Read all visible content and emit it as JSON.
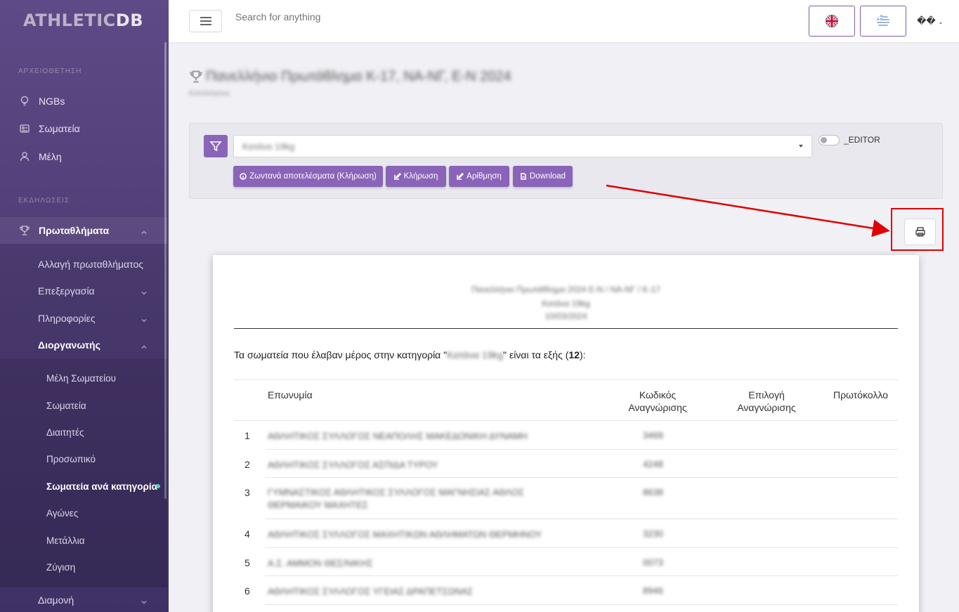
{
  "logo": {
    "part1": "ATHLETIC",
    "part2": "DB"
  },
  "sidebar": {
    "section1": "ΑΡΧΕΙΟΘΕΤΗΣΗ",
    "section2": "ΕΚΔΗΛΩΣΕΙΣ",
    "items": {
      "ngbs": "NGBs",
      "clubs": "Σωματεία",
      "members": "Μέλη",
      "championships": "Πρωταθλήματα",
      "change_championship": "Αλλαγή πρωταθλήματος",
      "editing": "Επεξεργασία",
      "info": "Πληροφορίες",
      "organizer": "Διοργανωτής",
      "club_members": "Μέλη Σωματείου",
      "org_clubs": "Σωματεία",
      "referees": "Διαιτητές",
      "staff": "Προσωπικό",
      "clubs_by_category": "Σωματεία ανά κατηγορία",
      "matches": "Αγώνες",
      "medals": "Μετάλλια",
      "weighing": "Ζύγιση",
      "accommodation": "Διαμονή"
    }
  },
  "topbar": {
    "search_placeholder": "Search for anything",
    "user_label": "��",
    "accent": "#7d5ea8"
  },
  "page": {
    "title": "Πανελλήνιο Πρωτάθλημα Κ-17, ΝΑ-ΝΓ, Ε-Ν 2024",
    "subtitle": "Καταλόγους"
  },
  "filter": {
    "selected": "Κατάνα 19kg",
    "toggle_label": "_EDITOR",
    "buttons": {
      "live": "Ζωντανά αποτελέσματα (Κλήρωση)",
      "draw": "Κλήρωση",
      "numbering": "Αρίθμηση",
      "download": "Download"
    },
    "accent": "#8a64b8"
  },
  "report": {
    "header_line1": "Πανελλήνιο Πρωτάθλημα 2024 Ε-Ν / ΝΑ-ΝΓ / Κ-17",
    "header_line2": "Κατάνα 19kg",
    "header_line3": "10/03/2024",
    "desc_before": "Τα σωματεία που έλαβαν μέρος στην κατηγορία \"",
    "desc_category": "Κατάνα 19kg",
    "desc_after": "\" είναι τα εξής (",
    "desc_count": "12",
    "desc_end": "):",
    "columns": {
      "name": "Επωνυμία",
      "code_line1": "Κωδικός",
      "code_line2": "Αναγνώρισης",
      "choice_line1": "Επιλογή",
      "choice_line2": "Αναγνώρισης",
      "protocol": "Πρωτόκολλο"
    },
    "rows": [
      {
        "n": "1",
        "name": "ΑΘΛΗΤΙΚΟΣ ΣΥΛΛΟΓΟΣ ΝΕΑΠΟΛΗΣ ΜΑΚΕΔΟΝΙΚΗ ΔΥΝΑΜΗ",
        "code": "3469"
      },
      {
        "n": "2",
        "name": "ΑΘΛΗΤΙΚΟΣ ΣΥΛΛΟΓΟΣ ΑΣΠΙΔΑ ΤΥΡΟΥ",
        "code": "4248"
      },
      {
        "n": "3",
        "name": "ΓΥΜΝΑΣΤΙΚΟΣ ΑΘΛΗΤΙΚΟΣ ΣΥΛΛΟΓΟΣ ΜΑΓΝΗΣΙΑΣ ΑΘΛΟΣ ΘΕΡΜΑΙΚΟΥ ΜΑΧΗΤΕΣ",
        "code": "8638"
      },
      {
        "n": "4",
        "name": "ΑΘΛΗΤΙΚΟΣ ΣΥΛΛΟΓΟΣ ΜΑΧΗΤΙΚΩΝ ΑΘΛΗΜΑΤΩΝ ΘΕΡΜΗΝΟΥ",
        "code": "3230"
      },
      {
        "n": "5",
        "name": "Α.Σ. ΑΜΜΟΝ ΘΕΣ/ΝΙΚΗΣ",
        "code": "0073"
      },
      {
        "n": "6",
        "name": "ΑΘΛΗΤΙΚΟΣ ΣΥΛΛΟΓΟΣ ΥΓΕΙΑΣ ΔΡΑΠΕΤΣΩΝΑΣ",
        "code": "8946"
      }
    ]
  }
}
